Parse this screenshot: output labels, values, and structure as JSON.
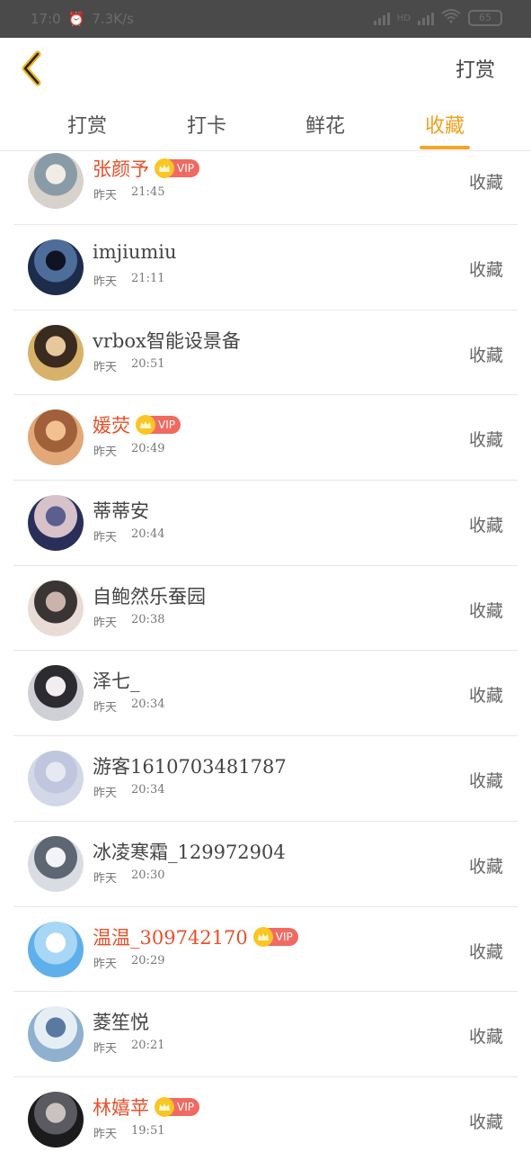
{
  "status_bar": {
    "time": "17:0",
    "speed": "7.3K/s",
    "net": "HD",
    "battery": "65"
  },
  "nav": {
    "back_icon": "chevron-left-icon",
    "action_label": "打赏",
    "accent": "#f5a623"
  },
  "tabs": [
    {
      "label": "打赏",
      "active": false
    },
    {
      "label": "打卡",
      "active": false
    },
    {
      "label": "鲜花",
      "active": false
    },
    {
      "label": "收藏",
      "active": true
    }
  ],
  "list": [
    {
      "name": "张颜予",
      "vip": true,
      "day": "昨天",
      "time": "21:45",
      "action": "收藏",
      "avatar_colors": [
        "#d8d2cc",
        "#8a9ba8",
        "#f1ece6"
      ]
    },
    {
      "name": "imjiumiu",
      "vip": false,
      "day": "昨天",
      "time": "21:11",
      "action": "收藏",
      "avatar_colors": [
        "#1d2c4a",
        "#4e6d9a",
        "#0f1422"
      ]
    },
    {
      "name": "vrbox智能设景备",
      "vip": false,
      "day": "昨天",
      "time": "20:51",
      "action": "收藏",
      "avatar_colors": [
        "#d8b16a",
        "#3a2b20",
        "#e7c89a"
      ]
    },
    {
      "name": "媛荧",
      "vip": true,
      "day": "昨天",
      "time": "20:49",
      "action": "收藏",
      "avatar_colors": [
        "#e3a877",
        "#a0603a",
        "#f1c190"
      ]
    },
    {
      "name": "蒂蒂安",
      "vip": false,
      "day": "昨天",
      "time": "20:44",
      "action": "收藏",
      "avatar_colors": [
        "#2a2f5a",
        "#d7c2c9",
        "#5b5e8e"
      ]
    },
    {
      "name": "自鲍然乐蚕园",
      "vip": false,
      "day": "昨天",
      "time": "20:38",
      "action": "收藏",
      "avatar_colors": [
        "#e9dcd6",
        "#3a3535",
        "#c9b3aa"
      ]
    },
    {
      "name": "泽七_",
      "vip": false,
      "day": "昨天",
      "time": "20:34",
      "action": "收藏",
      "avatar_colors": [
        "#cfcfd6",
        "#2b2b30",
        "#f2eef0"
      ]
    },
    {
      "name": "游客1610703481787",
      "vip": false,
      "day": "昨天",
      "time": "20:34",
      "action": "收藏",
      "avatar_colors": [
        "#d3d8e8",
        "#bfc6dd",
        "#e6e9f2"
      ]
    },
    {
      "name": "冰凌寒霜_129972904",
      "vip": false,
      "day": "昨天",
      "time": "20:30",
      "action": "收藏",
      "avatar_colors": [
        "#d9dde3",
        "#5d6672",
        "#f3f4f6"
      ]
    },
    {
      "name": "温温_309742170",
      "vip": true,
      "day": "昨天",
      "time": "20:29",
      "action": "收藏",
      "avatar_colors": [
        "#5fb0ea",
        "#a8d7f5",
        "#ffffff"
      ]
    },
    {
      "name": "菱笙悦",
      "vip": false,
      "day": "昨天",
      "time": "20:21",
      "action": "收藏",
      "avatar_colors": [
        "#8fb0cf",
        "#e6eef5",
        "#5a79a0"
      ]
    },
    {
      "name": "林嬉苹",
      "vip": true,
      "day": "昨天",
      "time": "19:51",
      "action": "收藏",
      "avatar_colors": [
        "#1b1b1e",
        "#5a5a60",
        "#c9c2c0"
      ]
    }
  ],
  "vip_label": "VIP",
  "colors": {
    "vip_name": "#e8502a",
    "vip_badge": "#f06a62",
    "crown": "#f9c624"
  }
}
